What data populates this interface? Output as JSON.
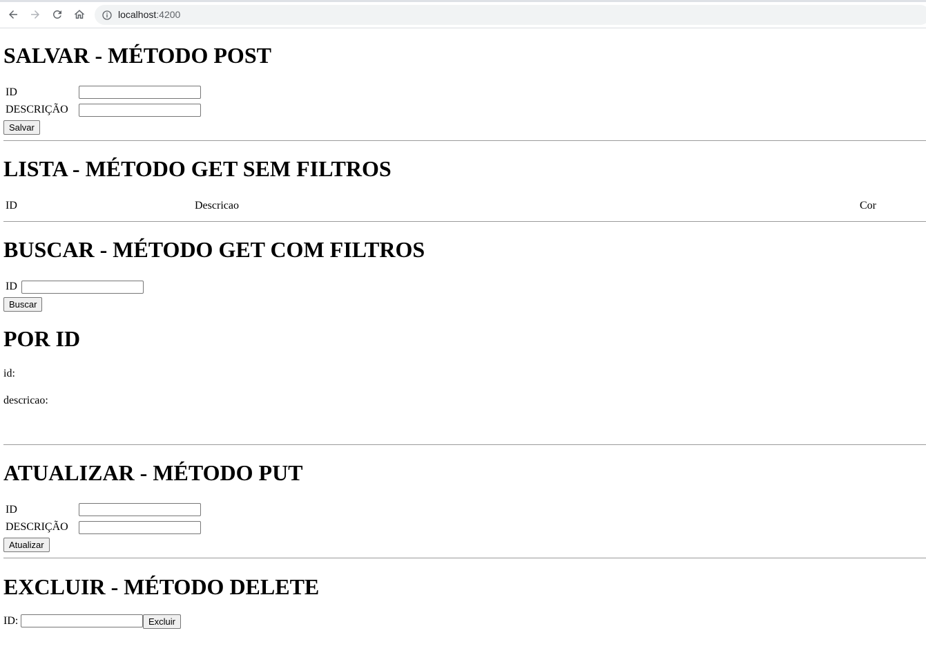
{
  "browser": {
    "url_host": "localhost",
    "url_port": ":4200"
  },
  "salvar": {
    "title": "SALVAR - MÉTODO POST",
    "id_label": "ID",
    "id_value": "",
    "descricao_label": "DESCRIÇÃO",
    "descricao_value": "",
    "button_label": "Salvar"
  },
  "lista": {
    "title": "LISTA - MÉTODO GET SEM FILTROS",
    "columns": [
      "ID",
      "Descricao",
      "Cor"
    ]
  },
  "buscar": {
    "title": "BUSCAR - MÉTODO GET COM FILTROS",
    "id_label": "ID",
    "id_value": "",
    "button_label": "Buscar"
  },
  "por_id": {
    "title": "POR ID",
    "id_label": "id:",
    "descricao_label": "descricao:"
  },
  "atualizar": {
    "title": "ATUALIZAR - MÉTODO PUT",
    "id_label": "ID",
    "id_value": "",
    "descricao_label": "DESCRIÇÃO",
    "descricao_value": "",
    "button_label": "Atualizar"
  },
  "excluir": {
    "title": "EXCLUIR - MÉTODO DELETE",
    "id_label": "ID:",
    "id_value": "",
    "button_label": "Excluir"
  }
}
